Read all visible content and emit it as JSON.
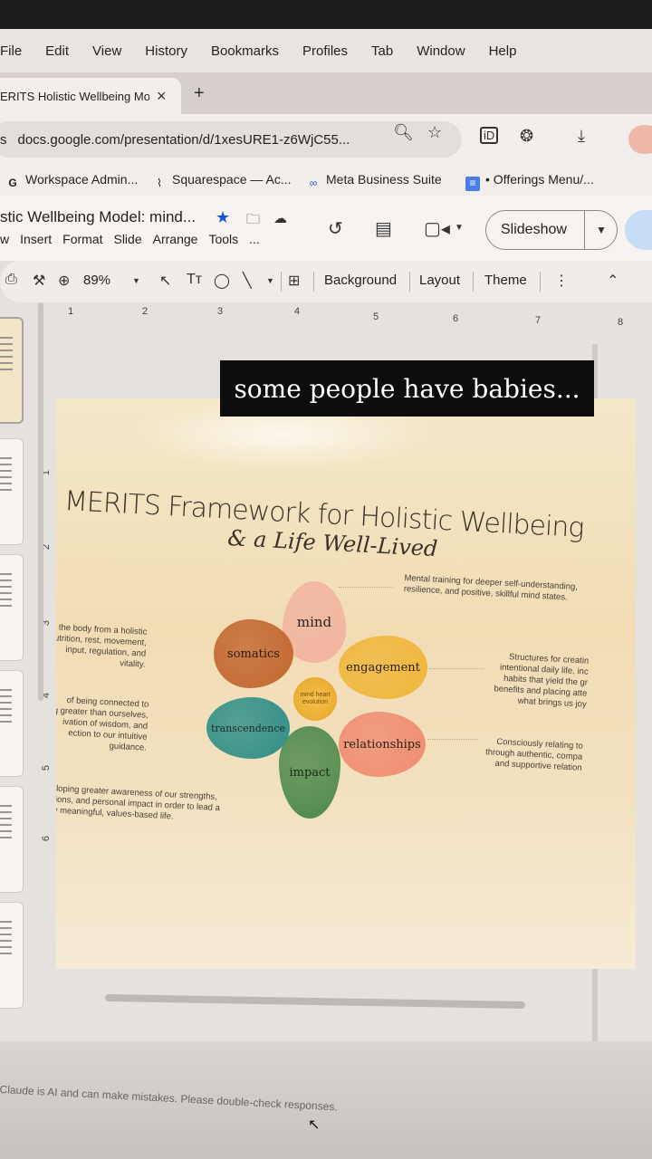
{
  "menubar": {
    "items": [
      "File",
      "Edit",
      "View",
      "History",
      "Bookmarks",
      "Profiles",
      "Tab",
      "Window",
      "Help"
    ]
  },
  "tab": {
    "title": "ERITS Holistic Wellbeing Mo",
    "close": "×",
    "new": "+"
  },
  "address": {
    "url": "docs.google.com/presentation/d/1xesURE1-z6WjC55...",
    "prefix": "s"
  },
  "bookmarks": [
    {
      "icon": "G",
      "label": "Workspace Admin..."
    },
    {
      "icon": "squarespace-icon",
      "label": "Squarespace — Ac..."
    },
    {
      "icon": "meta-icon",
      "label": "Meta Business Suite"
    },
    {
      "icon": "docs-icon",
      "label": "• Offerings Menu/..."
    }
  ],
  "doc": {
    "title": "stic Wellbeing Model: mind...",
    "menu": [
      "w",
      "Insert",
      "Format",
      "Slide",
      "Arrange",
      "Tools",
      "..."
    ],
    "slideshow_label": "Slideshow"
  },
  "toolbar": {
    "zoom": "89%",
    "background": "Background",
    "layout": "Layout",
    "theme": "Theme"
  },
  "ruler": {
    "top": [
      "1",
      "2",
      "3",
      "4",
      "5",
      "6",
      "7",
      "8"
    ],
    "left": [
      "1",
      "2",
      "3",
      "4",
      "5",
      "6"
    ]
  },
  "slide": {
    "title": "MERITS Framework for Holistic Wellbeing",
    "subtitle": "& a Life Well-Lived",
    "center": "mind heart evolution",
    "petals": {
      "mind": "mind",
      "engagement": "engagement",
      "relationships": "relationships",
      "impact": "impact",
      "transcendence": "transcendence",
      "somatics": "somatics"
    },
    "descriptions": {
      "mind": "Mental training for deeper self-understanding,\nresilience, and positive, skillful mind states.",
      "engagement": "Structures for creatin\nintentional daily life, inc\nhabits that yield the gr\nbenefits and placing atte\nwhat brings us joy",
      "relationships": "Consciously relating to\nthrough authentic, compa\nand supportive relation",
      "impact": "eveloping greater awareness of our strengths,\nassions, and personal impact in order to lead a\ntruly meaningful, values-based life.",
      "transcendence": "of being connected to\ng greater than ourselves,\nivation of wisdom, and\nection to our intuitive\nguidance.",
      "somatics": "r the body from a holistic\nutrition, rest, movement,\ninput, regulation, and\nvitality."
    },
    "colors": {
      "mind": "#f2b4a0",
      "engagement": "#f0b63a",
      "relationships": "#f08c72",
      "impact": "#4e8a4c",
      "transcendence": "#2f8f88",
      "somatics": "#c2662e"
    }
  },
  "caption": "some people have babies...",
  "bottom_note": "Claude is AI and can make mistakes. Please double-check responses."
}
